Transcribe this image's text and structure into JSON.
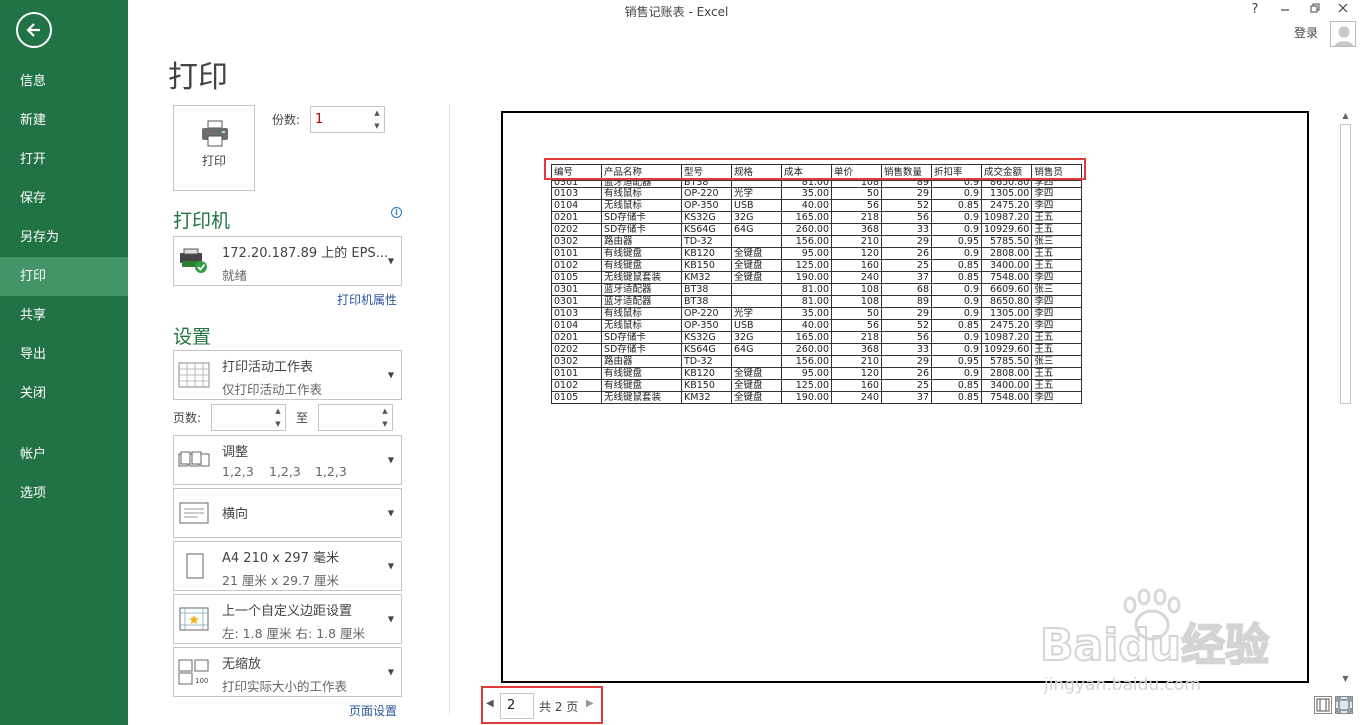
{
  "window": {
    "title": "销售记账表 - Excel",
    "login": "登录",
    "help": "?"
  },
  "sidebar": {
    "items": [
      {
        "label": "信息"
      },
      {
        "label": "新建"
      },
      {
        "label": "打开"
      },
      {
        "label": "保存"
      },
      {
        "label": "另存为"
      },
      {
        "label": "打印",
        "active": true
      },
      {
        "label": "共享"
      },
      {
        "label": "导出"
      },
      {
        "label": "关闭"
      },
      {
        "label": "帐户"
      },
      {
        "label": "选项"
      }
    ]
  },
  "print": {
    "title": "打印",
    "button_label": "打印",
    "copies_label": "份数:",
    "copies_value": "1"
  },
  "printer": {
    "section_title": "打印机",
    "name": "172.20.187.89 上的 EPS...",
    "status": "就绪",
    "properties_link": "打印机属性"
  },
  "settings": {
    "section_title": "设置",
    "what_to_print": {
      "line1": "打印活动工作表",
      "line2": "仅打印活动工作表"
    },
    "pages_label": "页数:",
    "to_label": "至",
    "collation": {
      "line1": "调整",
      "line2a": "1,2,3",
      "line2b": "1,2,3",
      "line2c": "1,2,3"
    },
    "orientation": {
      "line1": "横向"
    },
    "paper": {
      "line1": "A4 210 x 297 毫米",
      "line2": "21 厘米 x 29.7 厘米"
    },
    "margins": {
      "line1": "上一个自定义边距设置",
      "line2": "左: 1.8 厘米     右: 1.8 厘米"
    },
    "scaling": {
      "line1": "无缩放",
      "line2": "打印实际大小的工作表"
    },
    "page_setup_link": "页面设置"
  },
  "preview": {
    "headers": [
      "编号",
      "产品名称",
      "型号",
      "规格",
      "成本",
      "单价",
      "销售数量",
      "折扣率",
      "成交金额",
      "销售员"
    ],
    "partial_row": [
      "0301",
      "蓝牙适配器",
      "BT38",
      "",
      "81.00",
      "108",
      "89",
      "0.9",
      "8650.80",
      "李四"
    ],
    "rows": [
      [
        "0103",
        "有线鼠标",
        "OP-220",
        "光学",
        "35.00",
        "50",
        "29",
        "0.9",
        "1305.00",
        "李四"
      ],
      [
        "0104",
        "无线鼠标",
        "OP-350",
        "USB",
        "40.00",
        "56",
        "52",
        "0.85",
        "2475.20",
        "李四"
      ],
      [
        "0201",
        "SD存储卡",
        "KS32G",
        "32G",
        "165.00",
        "218",
        "56",
        "0.9",
        "10987.20",
        "王五"
      ],
      [
        "0202",
        "SD存储卡",
        "KS64G",
        "64G",
        "260.00",
        "368",
        "33",
        "0.9",
        "10929.60",
        "王五"
      ],
      [
        "0302",
        "路由器",
        "TD-32",
        "",
        "156.00",
        "210",
        "29",
        "0.95",
        "5785.50",
        "张三"
      ],
      [
        "0101",
        "有线键盘",
        "KB120",
        "全键盘",
        "95.00",
        "120",
        "26",
        "0.9",
        "2808.00",
        "王五"
      ],
      [
        "0102",
        "有线键盘",
        "KB150",
        "全键盘",
        "125.00",
        "160",
        "25",
        "0.85",
        "3400.00",
        "王五"
      ],
      [
        "0105",
        "无线键鼠套装",
        "KM32",
        "全键盘",
        "190.00",
        "240",
        "37",
        "0.85",
        "7548.00",
        "李四"
      ],
      [
        "0301",
        "蓝牙适配器",
        "BT38",
        "",
        "81.00",
        "108",
        "68",
        "0.9",
        "6609.60",
        "张三"
      ],
      [
        "0301",
        "蓝牙适配器",
        "BT38",
        "",
        "81.00",
        "108",
        "89",
        "0.9",
        "8650.80",
        "李四"
      ],
      [
        "0103",
        "有线鼠标",
        "OP-220",
        "光学",
        "35.00",
        "50",
        "29",
        "0.9",
        "1305.00",
        "李四"
      ],
      [
        "0104",
        "无线鼠标",
        "OP-350",
        "USB",
        "40.00",
        "56",
        "52",
        "0.85",
        "2475.20",
        "李四"
      ],
      [
        "0201",
        "SD存储卡",
        "KS32G",
        "32G",
        "165.00",
        "218",
        "56",
        "0.9",
        "10987.20",
        "王五"
      ],
      [
        "0202",
        "SD存储卡",
        "KS64G",
        "64G",
        "260.00",
        "368",
        "33",
        "0.9",
        "10929.60",
        "王五"
      ],
      [
        "0302",
        "路由器",
        "TD-32",
        "",
        "156.00",
        "210",
        "29",
        "0.95",
        "5785.50",
        "张三"
      ],
      [
        "0101",
        "有线键盘",
        "KB120",
        "全键盘",
        "95.00",
        "120",
        "26",
        "0.9",
        "2808.00",
        "王五"
      ],
      [
        "0102",
        "有线键盘",
        "KB150",
        "全键盘",
        "125.00",
        "160",
        "25",
        "0.85",
        "3400.00",
        "王五"
      ],
      [
        "0105",
        "无线键鼠套装",
        "KM32",
        "全键盘",
        "190.00",
        "240",
        "37",
        "0.85",
        "7548.00",
        "李四"
      ]
    ]
  },
  "pager": {
    "current": "2",
    "total_label": "共 2 页"
  },
  "watermark": {
    "brand": "Baidu经验",
    "url": "jingyan.baidu.com"
  },
  "colors": {
    "sidebar": "#217346",
    "sidebar_active": "#439467",
    "highlight": "#e23b3b",
    "link": "#2b579a"
  }
}
